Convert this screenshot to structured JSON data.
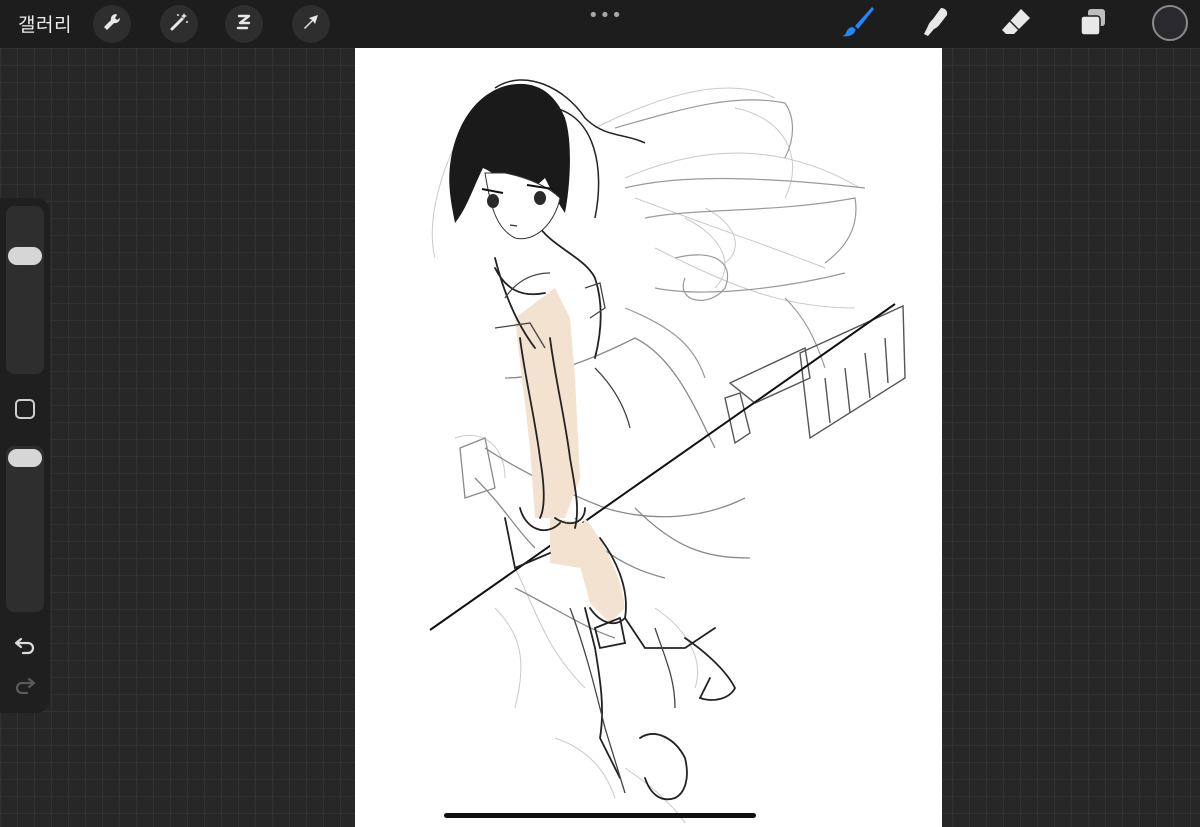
{
  "topbar": {
    "gallery_label": "갤러리",
    "more_label": "•••",
    "tools": [
      {
        "name": "actions",
        "icon": "wrench-icon"
      },
      {
        "name": "adjustments",
        "icon": "magic-wand-icon"
      },
      {
        "name": "selection",
        "icon": "selection-s-icon"
      },
      {
        "name": "transform",
        "icon": "arrow-cursor-icon"
      }
    ],
    "right_tools": [
      {
        "name": "brush",
        "icon": "brush-icon",
        "active": true
      },
      {
        "name": "smudge",
        "icon": "smudge-icon",
        "active": false
      },
      {
        "name": "eraser",
        "icon": "eraser-icon",
        "active": false
      },
      {
        "name": "layers",
        "icon": "layers-icon",
        "active": false
      }
    ],
    "current_color": "#2a2a2e",
    "active_tool_color": "#1e88ff"
  },
  "sidebar": {
    "size_slider": {
      "icon": "size-slider"
    },
    "modify_button": {
      "icon": "square-icon"
    },
    "opacity_slider": {
      "icon": "opacity-slider"
    },
    "undo": {
      "icon": "undo-icon"
    },
    "redo": {
      "icon": "redo-icon",
      "enabled": false
    }
  },
  "canvas": {
    "background": "#ffffff",
    "artwork": "sketch-illustration",
    "skin_color": "#f3e2d0"
  }
}
